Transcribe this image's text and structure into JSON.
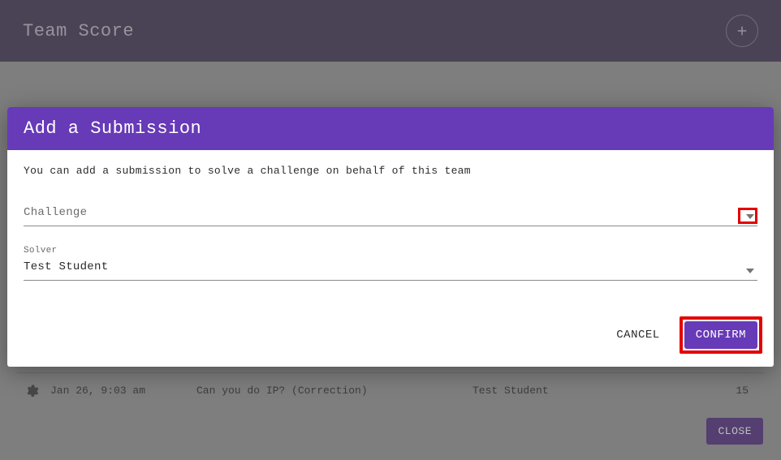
{
  "bg": {
    "title": "Team Score",
    "row": {
      "date": "Jan 26, 9:03 am",
      "challenge": "Can you do IP? (Correction)",
      "solver": "Test Student",
      "points": "15"
    },
    "close_label": "CLOSE"
  },
  "modal": {
    "title": "Add a Submission",
    "intro": "You can add a submission to solve a challenge on behalf of this team",
    "challenge": {
      "label": "Challenge",
      "value": ""
    },
    "solver": {
      "label": "Solver",
      "value": "Test Student"
    },
    "cancel_label": "CANCEL",
    "confirm_label": "CONFIRM"
  }
}
